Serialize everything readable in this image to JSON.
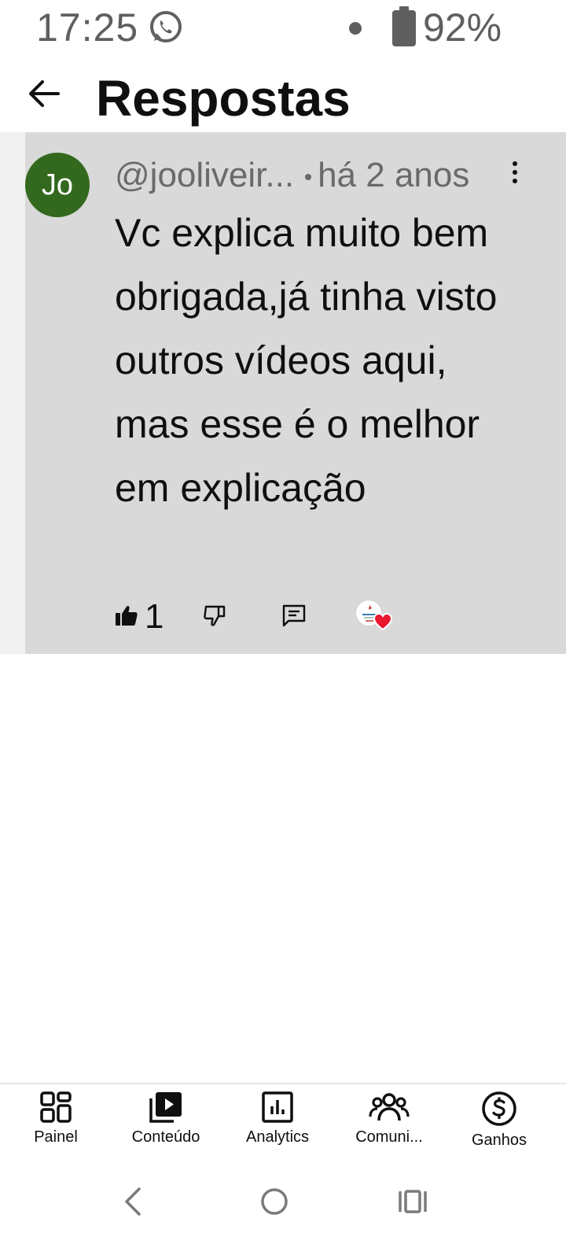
{
  "status_bar": {
    "time": "17:25",
    "battery_percent": "92%",
    "notification_icon": "whatsapp-icon",
    "battery_level": 0.92
  },
  "header": {
    "title": "Respostas",
    "back_icon": "arrow-back-icon"
  },
  "comment": {
    "avatar_initials": "Jo",
    "avatar_color": "#33691e",
    "author": "@jooliveir...",
    "time_ago": "há 2 anos",
    "text": "Vc explica muito bem obrigada,já tinha visto outros vídeos aqui, mas esse é o melhor em explicação",
    "like_count": "1",
    "heart_color": "#e8162f"
  },
  "bottom_nav": {
    "items": [
      {
        "label": "Painel",
        "icon": "dashboard-icon"
      },
      {
        "label": "Conteúdo",
        "icon": "content-icon"
      },
      {
        "label": "Analytics",
        "icon": "analytics-icon"
      },
      {
        "label": "Comuni...",
        "icon": "community-icon"
      },
      {
        "label": "Ganhos",
        "icon": "earnings-icon"
      }
    ]
  },
  "system_nav": {
    "icons": [
      "back-icon",
      "home-icon",
      "recents-icon"
    ]
  },
  "colors": {
    "card_background": "#d9d9d9",
    "card_outer": "#f1f1f1",
    "meta_text": "#6a6a6a",
    "status_text": "#5f5f5f"
  }
}
